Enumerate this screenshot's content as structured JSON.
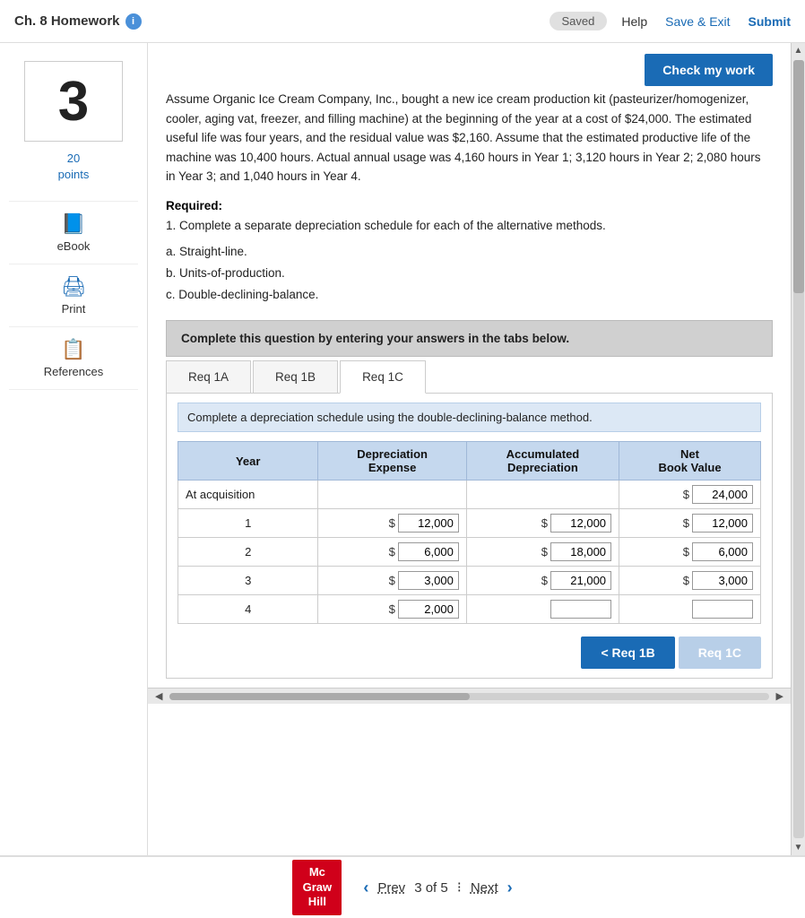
{
  "topNav": {
    "title": "Ch. 8 Homework",
    "infoIcon": "i",
    "savedLabel": "Saved",
    "helpLabel": "Help",
    "saveExitLabel": "Save & Exit",
    "submitLabel": "Submit"
  },
  "checkMyWork": "Check my work",
  "sidebar": {
    "questionNumber": "3",
    "pointsValue": "20",
    "pointsLabel": "points",
    "icons": [
      {
        "id": "ebook",
        "label": "eBook",
        "symbol": "📘"
      },
      {
        "id": "print",
        "label": "Print",
        "symbol": "🖨"
      },
      {
        "id": "references",
        "label": "References",
        "symbol": "📋"
      }
    ]
  },
  "questionText": "Assume Organic Ice Cream Company, Inc., bought a new ice cream production kit (pasteurizer/homogenizer, cooler, aging vat, freezer, and filling machine) at the beginning of the year at a cost of $24,000. The estimated useful life was four years, and the residual value was $2,160. Assume that the estimated productive life of the machine was 10,400 hours. Actual annual usage was 4,160 hours in Year 1; 3,120 hours in Year 2; 2,080 hours in Year 3; and 1,040 hours in Year 4.",
  "required": {
    "label": "Required:",
    "item1": "1. Complete a separate depreciation schedule for each of the alternative methods.",
    "methods": [
      "a. Straight-line.",
      "b. Units-of-production.",
      "c. Double-declining-balance."
    ]
  },
  "instructionBox": "Complete this question by entering your answers in the tabs below.",
  "tabs": [
    {
      "id": "req1a",
      "label": "Req 1A"
    },
    {
      "id": "req1b",
      "label": "Req 1B"
    },
    {
      "id": "req1c",
      "label": "Req 1C",
      "active": true
    }
  ],
  "tabContent": {
    "description": "Complete a depreciation schedule using the double-declining-balance method.",
    "tableHeaders": {
      "year": "Year",
      "depreciationExpense": "Depreciation\nExpense",
      "accumulatedDepreciation": "Accumulated\nDepreciation",
      "netBookValue": "Net\nBook Value"
    },
    "rows": [
      {
        "year": "At acquisition",
        "depExpSymbol": "",
        "depExpValue": "",
        "accDepSymbol": "",
        "accDepValue": "",
        "nbvSymbol": "$",
        "nbvValue": "24,000"
      },
      {
        "year": "1",
        "depExpSymbol": "$",
        "depExpValue": "12,000",
        "accDepSymbol": "$",
        "accDepValue": "12,000",
        "nbvSymbol": "$",
        "nbvValue": "12,000"
      },
      {
        "year": "2",
        "depExpSymbol": "$",
        "depExpValue": "6,000",
        "accDepSymbol": "$",
        "accDepValue": "18,000",
        "nbvSymbol": "$",
        "nbvValue": "6,000"
      },
      {
        "year": "3",
        "depExpSymbol": "$",
        "depExpValue": "3,000",
        "accDepSymbol": "$",
        "accDepValue": "21,000",
        "nbvSymbol": "$",
        "nbvValue": "3,000"
      },
      {
        "year": "4",
        "depExpSymbol": "$",
        "depExpValue": "2,000",
        "accDepSymbol": "",
        "accDepValue": "",
        "nbvSymbol": "",
        "nbvValue": ""
      }
    ]
  },
  "navButtons": {
    "prevReq": "< Req 1B",
    "nextReq": "Req 1C"
  },
  "footer": {
    "logo": {
      "line1": "Mc",
      "line2": "Graw",
      "line3": "Hill"
    },
    "prevLabel": "Prev",
    "pageInfo": "3 of 5",
    "nextLabel": "Next"
  }
}
